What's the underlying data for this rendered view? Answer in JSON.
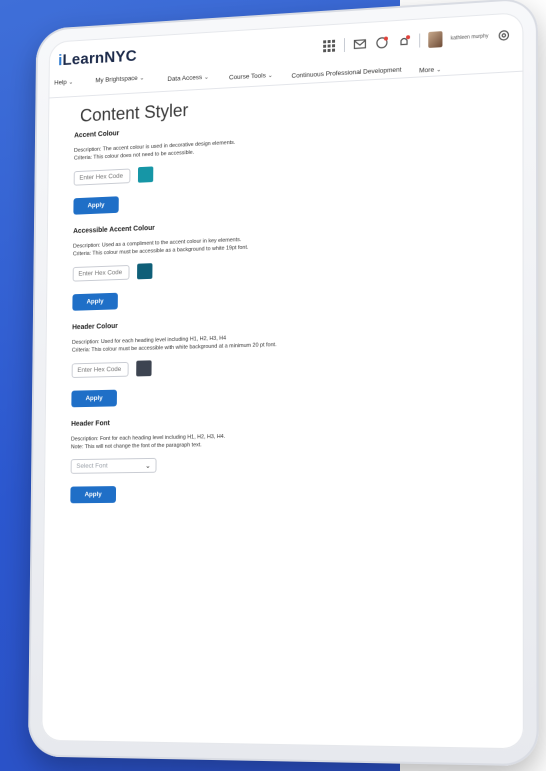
{
  "app": {
    "logo_prefix": "i",
    "logo_rest": "LearnNYC",
    "user_name": "kathleen murphy"
  },
  "nav": [
    {
      "label": "Help"
    },
    {
      "label": "My Brightspace"
    },
    {
      "label": "Data Access"
    },
    {
      "label": "Course Tools"
    },
    {
      "label": "Continuous Professional Development"
    },
    {
      "label": "More"
    }
  ],
  "page": {
    "title": "Content Styler"
  },
  "sections": [
    {
      "title": "Accent Colour",
      "desc1": "Description: The accent colour is used in decorative design elements.",
      "desc2": "Criteria: This colour does not need to be accessible.",
      "placeholder": "Enter Hex Code",
      "swatch": "#1696a6",
      "apply": "Apply"
    },
    {
      "title": "Accessible Accent Colour",
      "desc1": "Description: Used as a compliment to the accent colour in key elements.",
      "desc2": "Criteria: This colour must be accessible as a background to white 19pt font.",
      "placeholder": "Enter Hex Code",
      "swatch": "#0f5f78",
      "apply": "Apply"
    },
    {
      "title": "Header Colour",
      "desc1": "Description: Used for each heading level including H1, H2, H3, H4",
      "desc2": "Criteria: This colour must be accessible with white background at a minimum 20 pt font.",
      "placeholder": "Enter Hex Code",
      "swatch": "#3d4451",
      "apply": "Apply"
    },
    {
      "title": "Header Font",
      "desc1": "Description: Font for each heading level including H1, H2, H3, H4.",
      "desc2": "Note: This will not change the font of the paragraph text.",
      "select_value": "Select Font",
      "apply": "Apply"
    }
  ],
  "colors": {
    "brand_blue": "#2b57cf",
    "button_blue": "#1f6fc7"
  }
}
